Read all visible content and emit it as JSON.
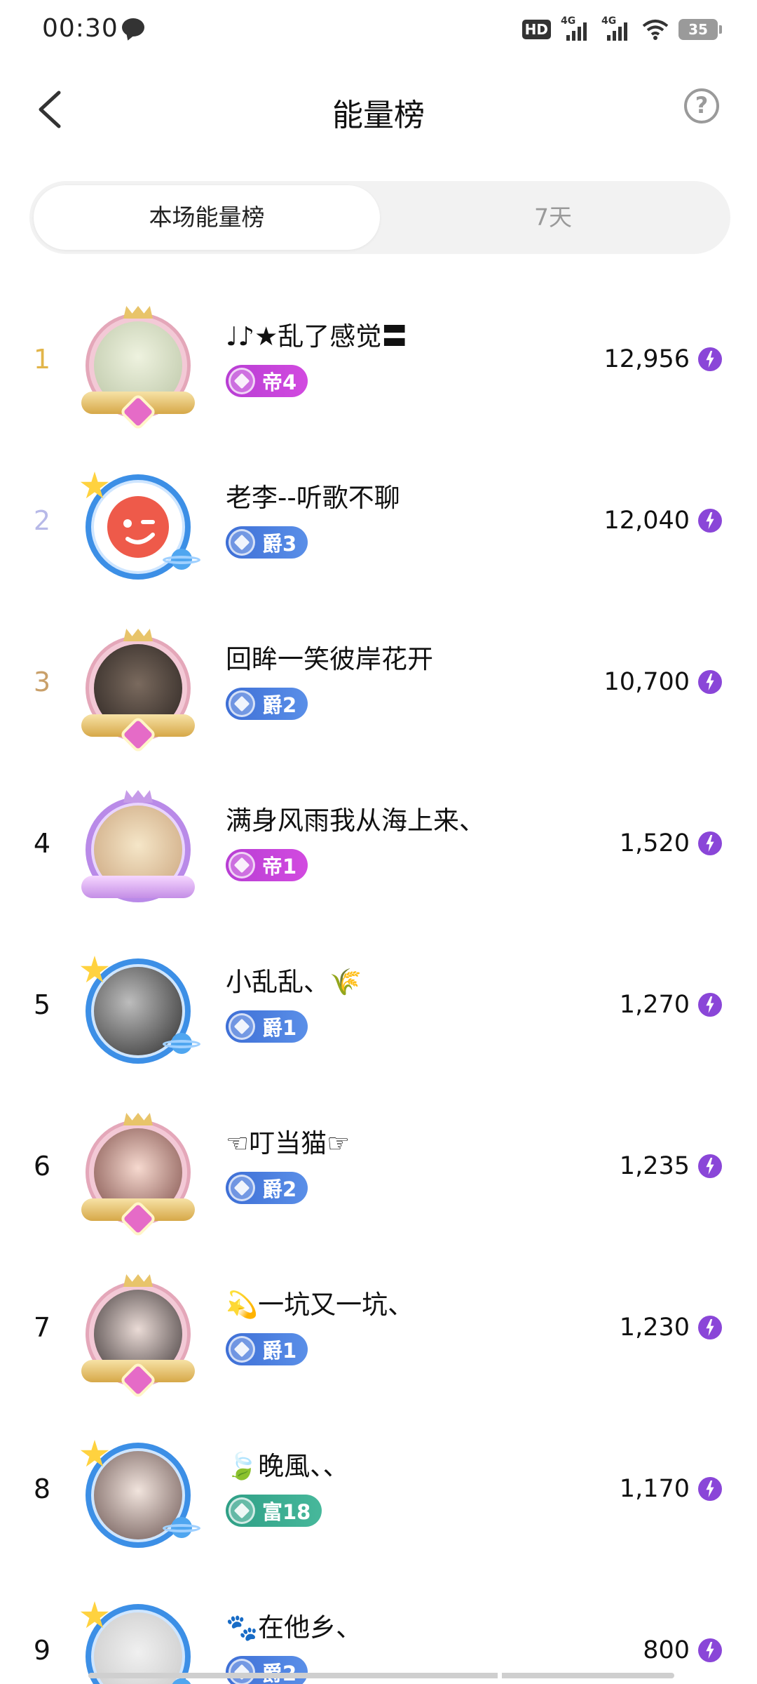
{
  "status_bar": {
    "time": "00:30",
    "hd_label": "HD",
    "signal_1_label": "4G",
    "signal_2_label": "4G",
    "battery": "35"
  },
  "header": {
    "title": "能量榜",
    "back_icon": "chevron-left-icon",
    "help_icon": "question-circle-icon",
    "help_glyph": "?"
  },
  "tabs": [
    {
      "label": "本场能量榜",
      "active": true
    },
    {
      "label": "7天",
      "active": false
    }
  ],
  "colors": {
    "emperor_badge": "#c443da",
    "noble_badge": "#4a7fe0",
    "rich_badge": "#3aab90",
    "energy_icon": "#8a46d8",
    "rank_gold": "#e2b54a",
    "rank_silver": "#b7b9e8",
    "rank_bronze": "#c9a06a"
  },
  "leaderboard": [
    {
      "rank": "1",
      "name": "♩♪★乱了感觉〓",
      "badge": "帝4",
      "badge_type": "emperor",
      "score": "12,956",
      "frame": "gold"
    },
    {
      "rank": "2",
      "name": "老李--听歌不聊",
      "badge": "爵3",
      "badge_type": "noble",
      "score": "12,040",
      "frame": "blue"
    },
    {
      "rank": "3",
      "name": "回眸一笑彼岸花开",
      "badge": "爵2",
      "badge_type": "noble",
      "score": "10,700",
      "frame": "gold"
    },
    {
      "rank": "4",
      "name": "满身风雨我从海上来、",
      "badge": "帝1",
      "badge_type": "emperor",
      "score": "1,520",
      "frame": "purple"
    },
    {
      "rank": "5",
      "name": "小乱乱、🌾",
      "badge": "爵1",
      "badge_type": "noble",
      "score": "1,270",
      "frame": "blue"
    },
    {
      "rank": "6",
      "name": "☜叮当猫☞",
      "badge": "爵2",
      "badge_type": "noble",
      "score": "1,235",
      "frame": "gold"
    },
    {
      "rank": "7",
      "name": "💫一坑又一坑、",
      "badge": "爵1",
      "badge_type": "noble",
      "score": "1,230",
      "frame": "gold"
    },
    {
      "rank": "8",
      "name": "🍃晚風、、",
      "badge": "富18",
      "badge_type": "rich",
      "score": "1,170",
      "frame": "blue"
    },
    {
      "rank": "9",
      "name": "🐾在他乡、",
      "badge": "爵2",
      "badge_type": "noble",
      "score": "800",
      "frame": "blue"
    }
  ]
}
